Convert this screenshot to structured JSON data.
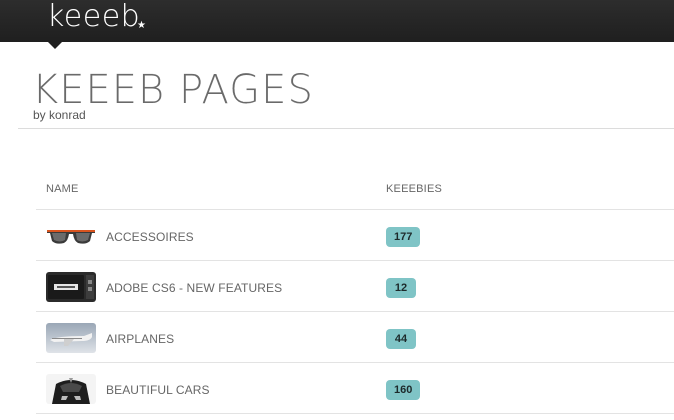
{
  "header": {
    "logo_text": "keeeb",
    "logo_star": "★"
  },
  "page": {
    "title": "KEEEB PAGES",
    "by_line": "by konrad"
  },
  "table": {
    "columns": [
      "NAME",
      "KEEEBIES"
    ],
    "rows": [
      {
        "name": "ACCESSOIRES",
        "count": "177",
        "thumb_icon": "sunglasses-icon"
      },
      {
        "name": "ADOBE CS6 - NEW FEATURES",
        "count": "12",
        "thumb_icon": "software-box-icon"
      },
      {
        "name": "AIRPLANES",
        "count": "44",
        "thumb_icon": "airplane-icon"
      },
      {
        "name": "BEAUTIFUL CARS",
        "count": "160",
        "thumb_icon": "car-icon"
      }
    ]
  },
  "colors": {
    "topbar": "#242424",
    "badge": "#7fc4c6"
  }
}
